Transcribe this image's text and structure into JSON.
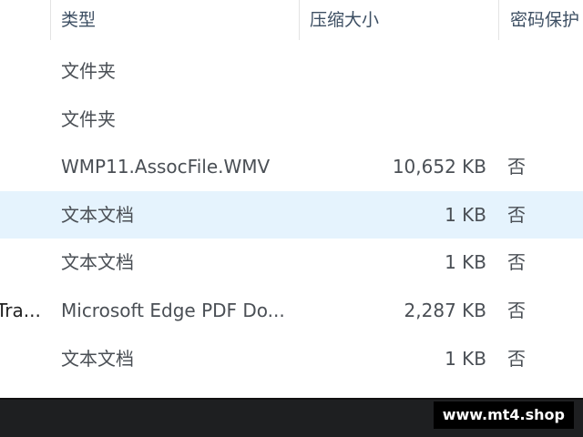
{
  "columns": {
    "type": "类型",
    "size": "压缩大小",
    "password": "密码保护"
  },
  "rows": [
    {
      "name": "",
      "type": "文件夹",
      "size": "",
      "password": "",
      "selected": false
    },
    {
      "name": "",
      "type": "文件夹",
      "size": "",
      "password": "",
      "selected": false
    },
    {
      "name": "",
      "type": "WMP11.AssocFile.WMV",
      "size": "10,652 KB",
      "password": "否",
      "selected": false
    },
    {
      "name": "",
      "type": "文本文档",
      "size": "1 KB",
      "password": "否",
      "selected": true
    },
    {
      "name": "",
      "type": "文本文档",
      "size": "1 KB",
      "password": "否",
      "selected": false
    },
    {
      "name": "Tra...",
      "type": "Microsoft Edge PDF Do...",
      "size": "2,287 KB",
      "password": "否",
      "selected": false
    },
    {
      "name": "",
      "type": "文本文档",
      "size": "1 KB",
      "password": "否",
      "selected": false
    }
  ],
  "watermark": "www.mt4.shop",
  "colors": {
    "selected_row": "#e5f3fd",
    "header_text": "#3d4f63",
    "footer": "#1e1f21"
  }
}
